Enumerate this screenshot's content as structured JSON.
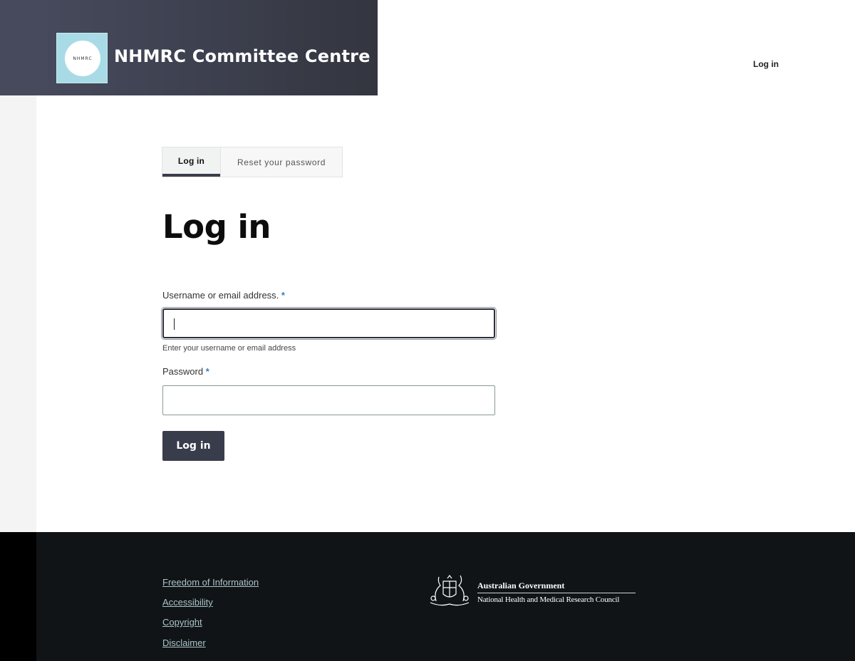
{
  "header": {
    "logo_text": "NHMRC",
    "site_name": "NHMRC Committee Centre",
    "nav_login": "Log in"
  },
  "tabs": [
    {
      "label": "Log in",
      "active": true
    },
    {
      "label": "Reset your password",
      "active": false
    }
  ],
  "page_title": "Log in",
  "form": {
    "username_label": "Username or email address.",
    "username_required": "*",
    "username_value": "",
    "username_hint": "Enter your username or email address",
    "password_label": "Password",
    "password_required": "*",
    "password_value": "",
    "submit_label": "Log in"
  },
  "footer": {
    "links": [
      "Freedom of Information",
      "Accessibility",
      "Copyright",
      "Disclaimer"
    ],
    "gov_line1": "Australian Government",
    "gov_line2": "National Health and Medical Research Council"
  },
  "colors": {
    "header_bg": "#3f4250",
    "logo_bg": "#a8dbe6",
    "button_bg": "#393c4b",
    "required_marker": "#3b7dbd",
    "footer_bg": "#111417",
    "footer_link": "#a9c4c8"
  }
}
